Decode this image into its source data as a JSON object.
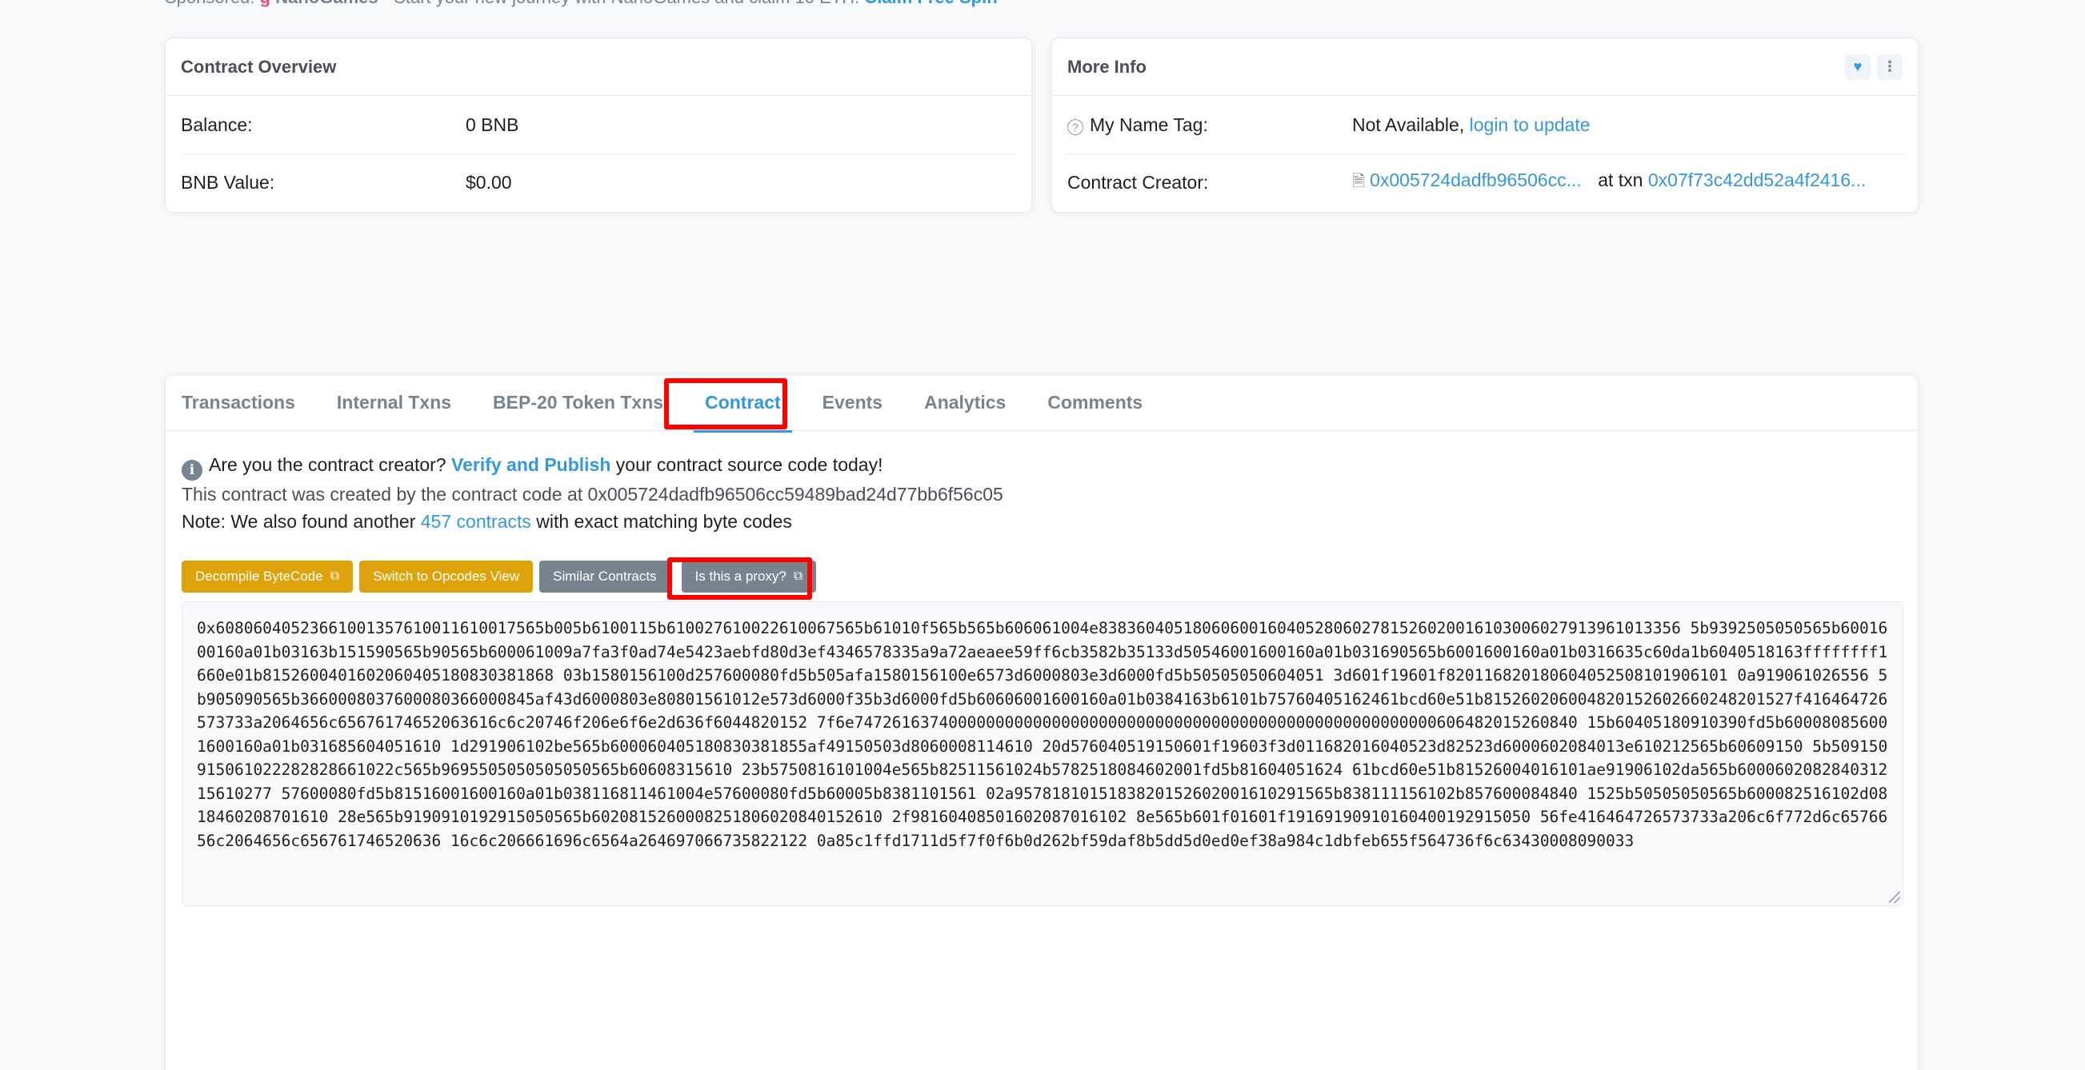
{
  "sponsor": {
    "prefix": "Sponsored:",
    "logo": "ɡ",
    "brand": "NanoGames",
    "text": "- Start your new journey with NanoGames and claim 10 ETH!",
    "cta": "Claim Free Spin"
  },
  "overview": {
    "title": "Contract Overview",
    "rows": [
      {
        "label": "Balance:",
        "value": "0 BNB"
      },
      {
        "label": "BNB Value:",
        "value": "$0.00"
      }
    ]
  },
  "moreinfo": {
    "title": "More Info",
    "heart_icon": "heart-icon",
    "more_icon": "more-vertical-icon",
    "name_tag_label": "My Name Tag:",
    "name_tag_value": "Not Available,",
    "name_tag_link": "login to update",
    "creator_label": "Contract Creator:",
    "creator_address": "0x005724dadfb96506cc...",
    "creator_at": "at txn",
    "creator_txn": "0x07f73c42dd52a4f2416..."
  },
  "tabs": [
    {
      "label": "Transactions",
      "active": false
    },
    {
      "label": "Internal Txns",
      "active": false
    },
    {
      "label": "BEP-20 Token Txns",
      "active": false
    },
    {
      "label": "Contract",
      "active": true
    },
    {
      "label": "Events",
      "active": false
    },
    {
      "label": "Analytics",
      "active": false
    },
    {
      "label": "Comments",
      "active": false
    }
  ],
  "contract": {
    "q_prefix": "Are you the contract creator?",
    "q_link": "Verify and Publish",
    "q_suffix": "your contract source code today!",
    "created_line": "This contract was created by the contract code at 0x005724dadfb96506cc59489bad24d77bb6f56c05",
    "note_prefix": "Note: We also found another",
    "note_link": "457 contracts",
    "note_suffix": "with exact matching byte codes",
    "buttons": {
      "decompile": "Decompile ByteCode",
      "opcodes": "Switch to Opcodes View",
      "similar": "Similar Contracts",
      "proxy": "Is this a proxy?"
    },
    "bytecode": "0x60806040523661001357610011610017565b005b6100115b610027610022610067565b61010f565b565b606061004e83836040518060600160405280602781526020016103006027913961013356 5b9392505050565b6001600160a01b03163b151590565b90565b600061009a7fa3f0ad74e5423aebfd80d3ef4346578335a9a72aeaee59ff6cb3582b35133d50546001600160a01b031690565b6001600160a01b0316635c60da1b6040518163ffffffff1660e01b8152600401602060405180830381868 03b1580156100d257600080fd5b505afa1580156100e6573d6000803e3d6000fd5b50505050604051 3d601f19601f820116820180604052508101906101 0a919061026556 5b905090565b3660008037600080366000845af43d6000803e80801561012e573d6000f35b3d6000fd5b60606001600160a01b0384163b6101b75760405162461bcd60e51b815260206004820152602660248201527f416464726573733a2064656c65676174652063616c6c20746f206e6f6e2d636f6044820152 7f6e74726163740000000000000000000000000000000000000000000000000000606482015260840 15b60405180910390fd5b600080856001600160a01b031685604051610 1d291906102be565b600060405180830381855af49150503d8060008114610 20d576040519150601f19603f3d011682016040523d82523d6000602084013e610212565b60609150 5b509150915061022282828661022c565b9695505050505050565b60608315610 23b5750816101004e565b82511561024b5782518084602001fd5b81604051624 61bcd60e51b81526004016101ae91906102da565b600060208284031215610277 57600080fd5b81516001600160a01b038116811461004e57600080fd5b60005b8381101561 02a9578181015183820152602001610291565b838111156102b857600084840 1525b50505050565b600082516102d0818460208701610 28e565b9190910192915050565b6020815260008251806020840152610 2f98160408501602087016102 8e565b601f01601f19169190910160400192915050 56fe416464726573733a206c6f772d6c6576656c2064656c656761746520636 16c6c206661696c6564a264697066735822122 0a85c1ffd1711d5f7f0f6b0d262bf59daf8b5dd5d0ed0ef38a984c1dbfeb655f564736f6c63430008090033"
  }
}
